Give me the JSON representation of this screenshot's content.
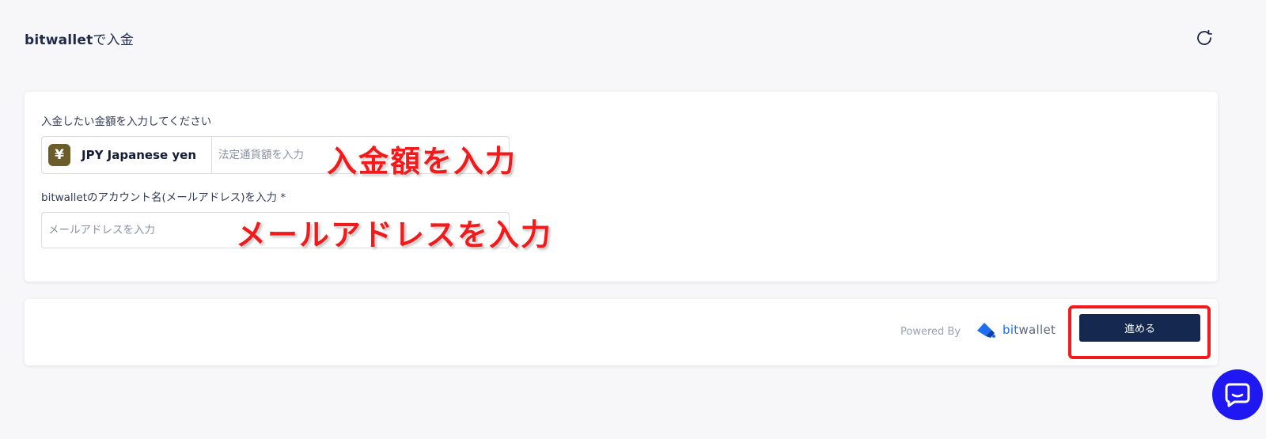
{
  "header": {
    "title_brand": "bitwallet",
    "title_rest": "で入金"
  },
  "form": {
    "amount_label": "入金したい金額を入力してください",
    "currency_code_label": "JPY Japanese yen",
    "currency_symbol": "¥",
    "amount_placeholder": "法定通貨額を入力",
    "account_label": "bitwalletのアカウント名(メールアドレス)を入力 *",
    "email_placeholder": "メールアドレスを入力"
  },
  "annotations": {
    "amount": "入金額を入力",
    "email": "メールアドレスを入力"
  },
  "footer": {
    "powered_by": "Powered By",
    "brand_bit": "bit",
    "brand_rest": "wallet",
    "proceed_label": "進める"
  },
  "colors": {
    "primary_button": "#142850",
    "annotation_red": "#f21a1a",
    "chat_bubble": "#1f18f2",
    "brand_blue": "#1d6ff2"
  },
  "icons": [
    "refresh-icon",
    "yen-icon",
    "bitwallet-logo-icon",
    "chat-icon"
  ]
}
